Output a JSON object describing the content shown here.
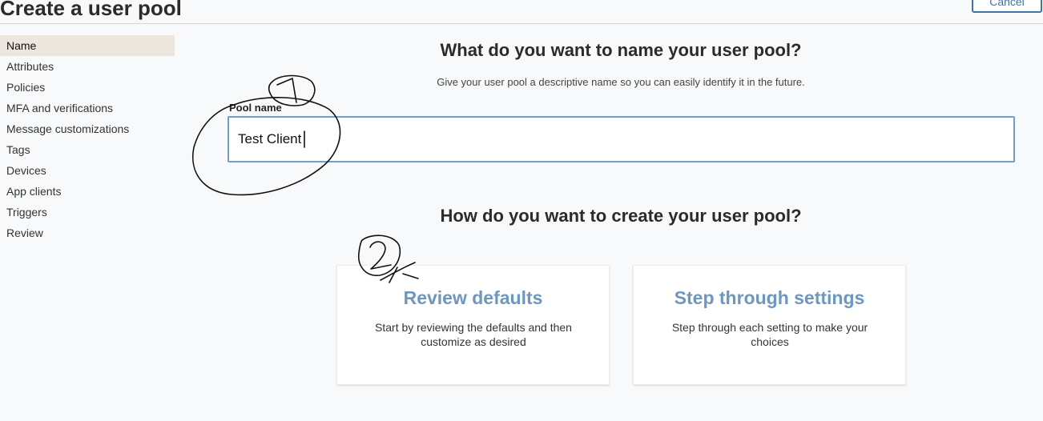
{
  "header": {
    "title": "Create a user pool",
    "cancel_label": "Cancel"
  },
  "sidebar": {
    "items": [
      {
        "label": "Name",
        "active": true
      },
      {
        "label": "Attributes"
      },
      {
        "label": "Policies"
      },
      {
        "label": "MFA and verifications"
      },
      {
        "label": "Message customizations"
      },
      {
        "label": "Tags"
      },
      {
        "label": "Devices"
      },
      {
        "label": "App clients"
      },
      {
        "label": "Triggers"
      },
      {
        "label": "Review"
      }
    ]
  },
  "main": {
    "name_heading": "What do you want to name your user pool?",
    "name_subheading": "Give your user pool a descriptive name so you can easily identify it in the future.",
    "pool_name_label": "Pool name",
    "pool_name_value": "Test Client",
    "create_heading": "How do you want to create your user pool?",
    "options": [
      {
        "title": "Review defaults",
        "description": "Start by reviewing the defaults and then customize as desired"
      },
      {
        "title": "Step through settings",
        "description": "Step through each setting to make your choices"
      }
    ]
  },
  "colors": {
    "accent": "#6c97c0",
    "cancel_border": "#3c74a8",
    "input_border": "#6f9fd0",
    "active_sidebar_bg": "#ece6df",
    "annotation_ink": "#111111"
  }
}
